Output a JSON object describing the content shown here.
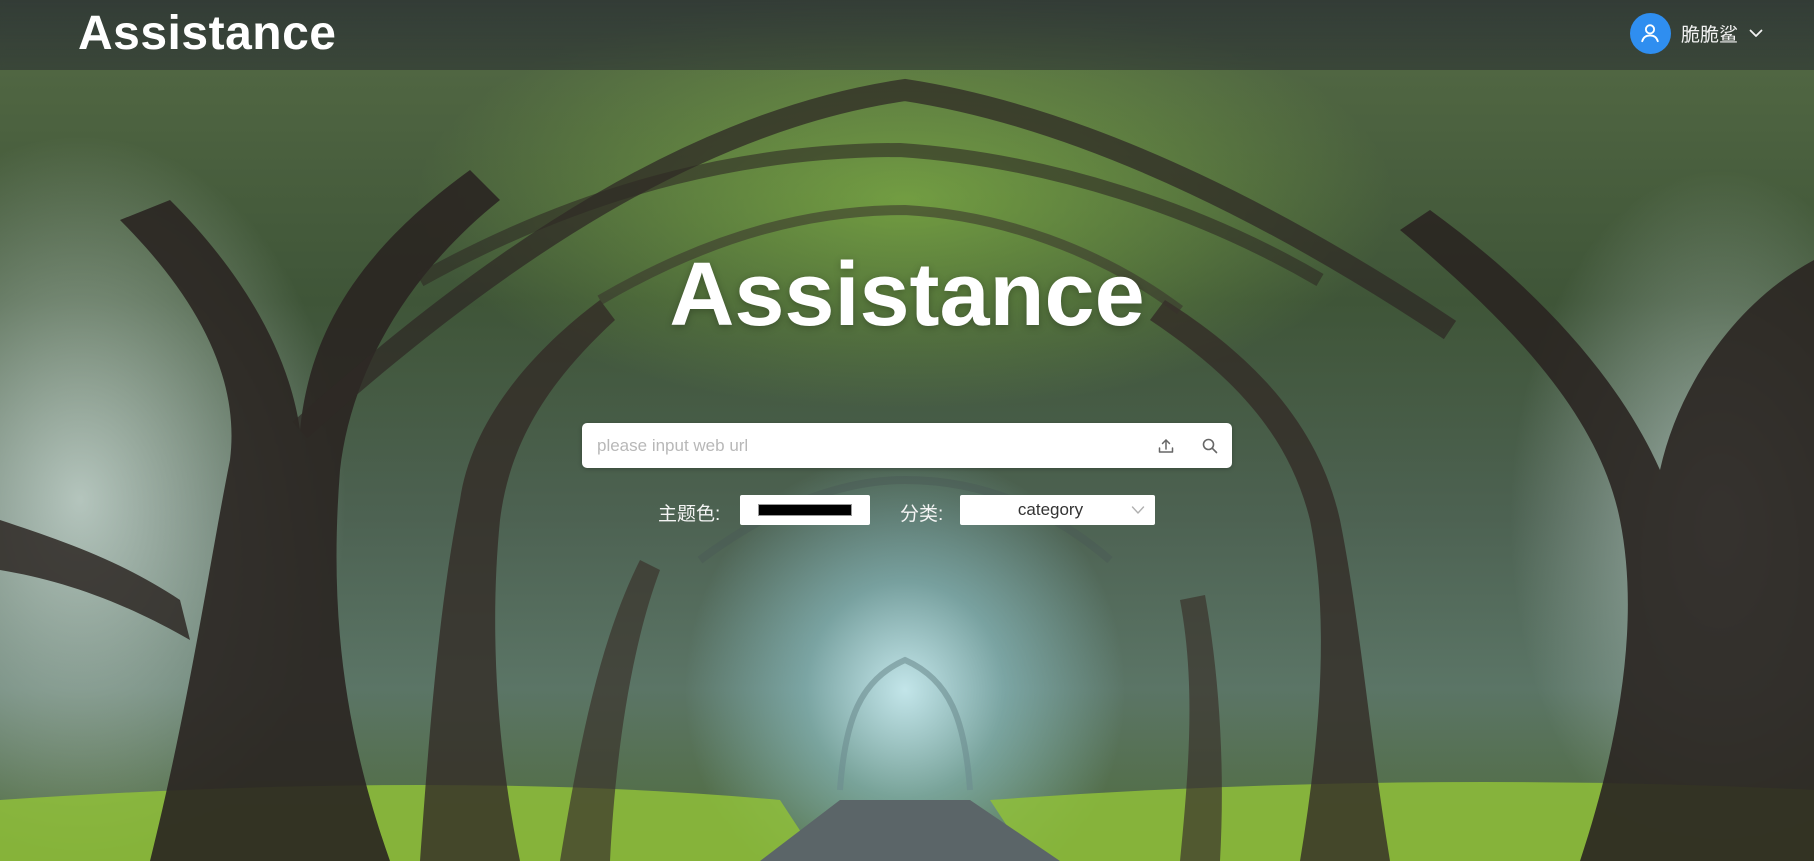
{
  "app": {
    "brand": "Assistance",
    "hero_title": "Assistance"
  },
  "user": {
    "name": "脆脆鲨",
    "avatar_icon": "user-icon",
    "menu_icon": "chevron-down-icon"
  },
  "search": {
    "placeholder": "please input web url",
    "value": "",
    "upload_icon": "upload-icon",
    "search_icon": "search-icon"
  },
  "options": {
    "theme_color_label": "主题色:",
    "theme_color_value": "#000000",
    "category_label": "分类:",
    "category_value": "category"
  },
  "colors": {
    "accent": "#2f8ef0",
    "topbar": "#2d3237",
    "input_bg": "#ffffff"
  }
}
